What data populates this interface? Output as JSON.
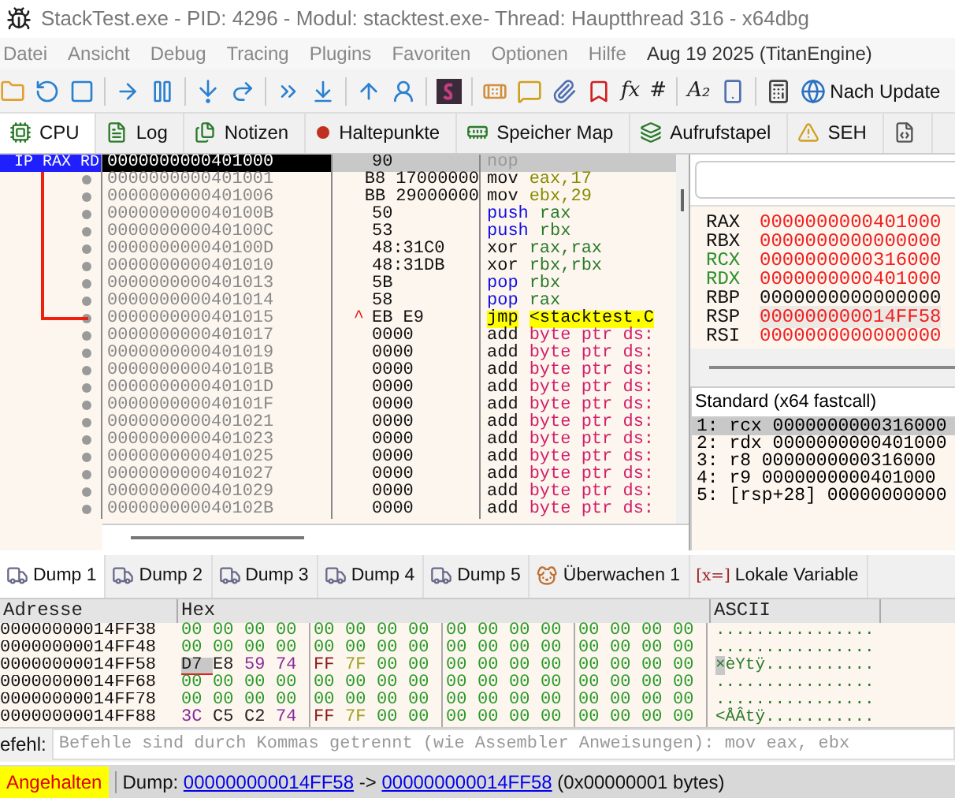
{
  "window": {
    "title": "StackTest.exe - PID: 4296 - Modul: stacktest.exe- Thread: Hauptthread 316 - x64dbg"
  },
  "menu": [
    "Datei",
    "Ansicht",
    "Debug",
    "Tracing",
    "Plugins",
    "Favoriten",
    "Optionen",
    "Hilfe"
  ],
  "build_info": "Aug 19 2025 (TitanEngine)",
  "toolbar": {
    "glyphs": [
      "fx",
      "#",
      "A₂"
    ],
    "update_button": "Nach Update"
  },
  "tabs": [
    {
      "label": "CPU",
      "selected": true
    },
    {
      "label": "Log",
      "selected": false
    },
    {
      "label": "Notizen",
      "selected": false
    },
    {
      "label": "Haltepunkte",
      "selected": false
    },
    {
      "label": "Speicher Map",
      "selected": false
    },
    {
      "label": "Aufrufstapel",
      "selected": false
    },
    {
      "label": "SEH",
      "selected": false
    }
  ],
  "disassembly": {
    "gutter_label": "IP RAX RD",
    "rows": [
      {
        "address": "0000000000401000",
        "bytes": "90",
        "mnemonic": "nop",
        "operands": "",
        "kind": "nop",
        "selected": true
      },
      {
        "address": "0000000000401001",
        "bytes": "B8 17000000",
        "mnemonic": "mov",
        "operands": "eax,17",
        "kind": "mov",
        "selected": false
      },
      {
        "address": "0000000000401006",
        "bytes": "BB 29000000",
        "mnemonic": "mov",
        "operands": "ebx,29",
        "kind": "mov",
        "selected": false
      },
      {
        "address": "000000000040100B",
        "bytes": "50",
        "mnemonic": "push",
        "operands": "rax",
        "kind": "stack",
        "selected": false
      },
      {
        "address": "000000000040100C",
        "bytes": "53",
        "mnemonic": "push",
        "operands": "rbx",
        "kind": "stack",
        "selected": false
      },
      {
        "address": "000000000040100D",
        "bytes": "48:31C0",
        "mnemonic": "xor",
        "operands": "rax,rax",
        "kind": "plain",
        "selected": false
      },
      {
        "address": "0000000000401010",
        "bytes": "48:31DB",
        "mnemonic": "xor",
        "operands": "rbx,rbx",
        "kind": "plain",
        "selected": false
      },
      {
        "address": "0000000000401013",
        "bytes": "5B",
        "mnemonic": "pop",
        "operands": "rbx",
        "kind": "stack",
        "selected": false
      },
      {
        "address": "0000000000401014",
        "bytes": "58",
        "mnemonic": "pop",
        "operands": "rax",
        "kind": "stack",
        "selected": false
      },
      {
        "address": "0000000000401015",
        "bytes": "EB E9",
        "mnemonic": "jmp",
        "operands": "<stacktest.C",
        "kind": "jump",
        "selected": false,
        "marker": "^"
      },
      {
        "address": "0000000000401017",
        "bytes": "0000",
        "mnemonic": "add",
        "operands": "byte ptr ds:",
        "kind": "memory",
        "selected": false
      },
      {
        "address": "0000000000401019",
        "bytes": "0000",
        "mnemonic": "add",
        "operands": "byte ptr ds:",
        "kind": "memory",
        "selected": false
      },
      {
        "address": "000000000040101B",
        "bytes": "0000",
        "mnemonic": "add",
        "operands": "byte ptr ds:",
        "kind": "memory",
        "selected": false
      },
      {
        "address": "000000000040101D",
        "bytes": "0000",
        "mnemonic": "add",
        "operands": "byte ptr ds:",
        "kind": "memory",
        "selected": false
      },
      {
        "address": "000000000040101F",
        "bytes": "0000",
        "mnemonic": "add",
        "operands": "byte ptr ds:",
        "kind": "memory",
        "selected": false
      },
      {
        "address": "0000000000401021",
        "bytes": "0000",
        "mnemonic": "add",
        "operands": "byte ptr ds:",
        "kind": "memory",
        "selected": false
      },
      {
        "address": "0000000000401023",
        "bytes": "0000",
        "mnemonic": "add",
        "operands": "byte ptr ds:",
        "kind": "memory",
        "selected": false
      },
      {
        "address": "0000000000401025",
        "bytes": "0000",
        "mnemonic": "add",
        "operands": "byte ptr ds:",
        "kind": "memory",
        "selected": false
      },
      {
        "address": "0000000000401027",
        "bytes": "0000",
        "mnemonic": "add",
        "operands": "byte ptr ds:",
        "kind": "memory",
        "selected": false
      },
      {
        "address": "0000000000401029",
        "bytes": "0000",
        "mnemonic": "add",
        "operands": "byte ptr ds:",
        "kind": "memory",
        "selected": false
      },
      {
        "address": "000000000040102B",
        "bytes": "0000",
        "mnemonic": "add",
        "operands": "byte ptr ds:",
        "kind": "memory",
        "selected": false
      }
    ]
  },
  "registers": [
    {
      "name": "RAX",
      "value": "0000000000401000",
      "changed": true,
      "highlighted": false,
      "selected": false
    },
    {
      "name": "RBX",
      "value": "0000000000000000",
      "changed": true,
      "highlighted": false,
      "selected": false
    },
    {
      "name": "RCX",
      "value": "0000000000316000",
      "changed": true,
      "highlighted": true,
      "selected": false
    },
    {
      "name": "RDX",
      "value": "0000000000401000",
      "changed": true,
      "highlighted": true,
      "selected": false
    },
    {
      "name": "RBP",
      "value": "0000000000000000",
      "changed": false,
      "highlighted": false,
      "selected": false
    },
    {
      "name": "RSP",
      "value": "000000000014FF58",
      "changed": true,
      "highlighted": false,
      "selected": true
    },
    {
      "name": "RSI",
      "value": "0000000000000000",
      "changed": true,
      "highlighted": false,
      "selected": false
    }
  ],
  "call_convention": {
    "title": "Standard (x64 fastcall)",
    "args": [
      {
        "text": "1: rcx 0000000000316000",
        "selected": true
      },
      {
        "text": "2: rdx 0000000000401000",
        "selected": false
      },
      {
        "text": "3: r8 0000000000316000",
        "selected": false
      },
      {
        "text": "4: r9 0000000000401000",
        "selected": false
      },
      {
        "text": "5: [rsp+28] 00000000000",
        "selected": false
      }
    ]
  },
  "dump_tabs": [
    {
      "label": "Dump 1",
      "selected": true,
      "kind": "dump"
    },
    {
      "label": "Dump 2",
      "selected": false,
      "kind": "dump"
    },
    {
      "label": "Dump 3",
      "selected": false,
      "kind": "dump"
    },
    {
      "label": "Dump 4",
      "selected": false,
      "kind": "dump"
    },
    {
      "label": "Dump 5",
      "selected": false,
      "kind": "dump"
    },
    {
      "label": "Überwachen 1",
      "selected": false,
      "kind": "watch"
    },
    {
      "label": "Lokale Variable",
      "selected": false,
      "kind": "locals",
      "glyph": "[x=]"
    }
  ],
  "dump": {
    "columns": [
      "Adresse",
      "Hex",
      "ASCII"
    ],
    "rows": [
      {
        "address": "00000000014FF38",
        "bytes": [
          "00",
          "00",
          "00",
          "00",
          "00",
          "00",
          "00",
          "00",
          "00",
          "00",
          "00",
          "00",
          "00",
          "00",
          "00",
          "00"
        ],
        "ascii": "................",
        "selected": false
      },
      {
        "address": "00000000014FF48",
        "bytes": [
          "00",
          "00",
          "00",
          "00",
          "00",
          "00",
          "00",
          "00",
          "00",
          "00",
          "00",
          "00",
          "00",
          "00",
          "00",
          "00"
        ],
        "ascii": "................",
        "selected": false
      },
      {
        "address": "00000000014FF58",
        "bytes": [
          "D7",
          "E8",
          "59",
          "74",
          "FF",
          "7F",
          "00",
          "00",
          "00",
          "00",
          "00",
          "00",
          "00",
          "00",
          "00",
          "00"
        ],
        "ascii": "×èYtÿ...........",
        "selected": true
      },
      {
        "address": "00000000014FF68",
        "bytes": [
          "00",
          "00",
          "00",
          "00",
          "00",
          "00",
          "00",
          "00",
          "00",
          "00",
          "00",
          "00",
          "00",
          "00",
          "00",
          "00"
        ],
        "ascii": "................",
        "selected": false
      },
      {
        "address": "00000000014FF78",
        "bytes": [
          "00",
          "00",
          "00",
          "00",
          "00",
          "00",
          "00",
          "00",
          "00",
          "00",
          "00",
          "00",
          "00",
          "00",
          "00",
          "00"
        ],
        "ascii": "................",
        "selected": false
      },
      {
        "address": "00000000014FF88",
        "bytes": [
          "3C",
          "C5",
          "C2",
          "74",
          "FF",
          "7F",
          "00",
          "00",
          "00",
          "00",
          "00",
          "00",
          "00",
          "00",
          "00",
          "00"
        ],
        "ascii": "<ÅÂtÿ...........",
        "selected": false
      }
    ]
  },
  "command": {
    "label": "efehl:",
    "placeholder": "Befehle sind durch Kommas getrennt (wie Assembler Anweisungen): mov eax, ebx"
  },
  "status": {
    "state": "Angehalten",
    "prefix": "Dump:",
    "from": "000000000014FF58",
    "arrow": "->",
    "to": "000000000014FF58",
    "suffix": "(0x00000001 bytes)"
  }
}
